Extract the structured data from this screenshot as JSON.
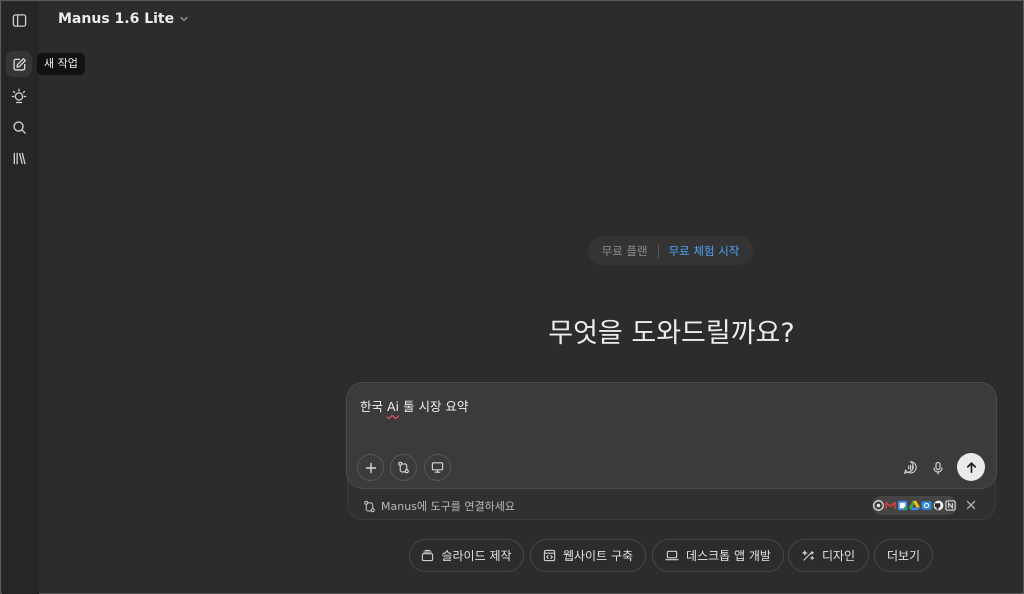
{
  "header": {
    "model_name": "Manus 1.6 Lite"
  },
  "sidebar": {
    "items": [
      {
        "icon": "sidebar-toggle-icon"
      },
      {
        "icon": "edit-icon",
        "tooltip": "새 작업"
      },
      {
        "icon": "agent-icon"
      },
      {
        "icon": "search-icon"
      },
      {
        "icon": "library-icon"
      }
    ]
  },
  "plan": {
    "label": "무료 플랜",
    "trial_link": "무료 체험 시작"
  },
  "main": {
    "headline": "무엇을 도와드릴까요?"
  },
  "composer": {
    "value_part1": "한국 ",
    "value_ai": "Ai",
    "value_part2": " 툴 시장 요약",
    "left_buttons": [
      "plus-icon",
      "connector-icon",
      "monitor-icon"
    ],
    "right_buttons": [
      "voice-chat-icon",
      "mic-icon"
    ],
    "send_icon": "arrow-up-icon"
  },
  "connect_bar": {
    "text": "Manus에 도구를 연결하세요",
    "tools": [
      "chrome-icon",
      "gmail-icon",
      "google-calendar-icon",
      "google-drive-icon",
      "outlook-icon",
      "github-icon",
      "notion-icon"
    ]
  },
  "quick_actions": [
    {
      "label": "슬라이드 제작",
      "icon": "slides-icon"
    },
    {
      "label": "웹사이트 구축",
      "icon": "website-icon"
    },
    {
      "label": "데스크톱 앱 개발",
      "icon": "laptop-icon"
    },
    {
      "label": "디자인",
      "icon": "design-icon"
    },
    {
      "label": "더보기"
    }
  ],
  "colors": {
    "background": "#2c2c2c",
    "rail": "#262626",
    "composer": "#3b3b3c",
    "accent_link": "#4da3f5",
    "send_button": "#eaeaea"
  }
}
